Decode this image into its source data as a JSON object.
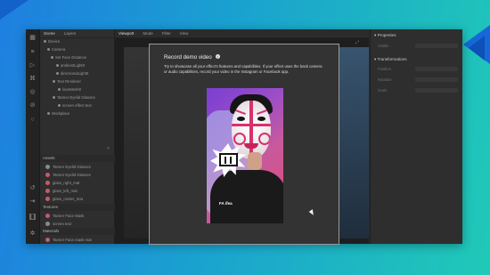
{
  "left_panel": {
    "tabs": [
      "Scene",
      "Layers"
    ],
    "tree": [
      "Device",
      "Camera",
      "Set Face Distance",
      "ambientLight0",
      "directionalLight0",
      "Text Renderer",
      "faceMesh0",
      "Tanner Eyelid Glasses",
      "screen effect text",
      "Workplace"
    ],
    "assets_header": "Assets",
    "assets": [
      "Tanner Eyelid Glasses",
      "Tanner Eyelid Glasses",
      "glass_right_mat",
      "glass_left_mat",
      "glass_center_mat"
    ],
    "textures_header": "Textures",
    "textures": [
      "Tanner Face Mask",
      "screen text"
    ],
    "materials_header": "Materials",
    "materials": [
      "Tanner Face mask mat"
    ]
  },
  "viewport": {
    "tabs": [
      "Viewport",
      "Mode",
      "Filter",
      "View"
    ]
  },
  "right_panel": {
    "header1": "Properties",
    "field1": "Visible",
    "header2": "Transformations",
    "fields": [
      "Position",
      "Rotation",
      "Scale"
    ]
  },
  "modal": {
    "title": "Record demo video",
    "info_icon": "info-icon",
    "description": "Try to showcase all your effect's features and capabilities. If your effect uses the back camera or audio capabilities, record your video in the Instagram or Facebook app.",
    "video_watermark": "FA ifea"
  },
  "colors": {
    "background_start": "#1e7fe0",
    "background_end": "#20c9b7",
    "app_bg": "#2b2b2b",
    "modal_bg": "#333333",
    "mask_pink": "#d8306e"
  }
}
